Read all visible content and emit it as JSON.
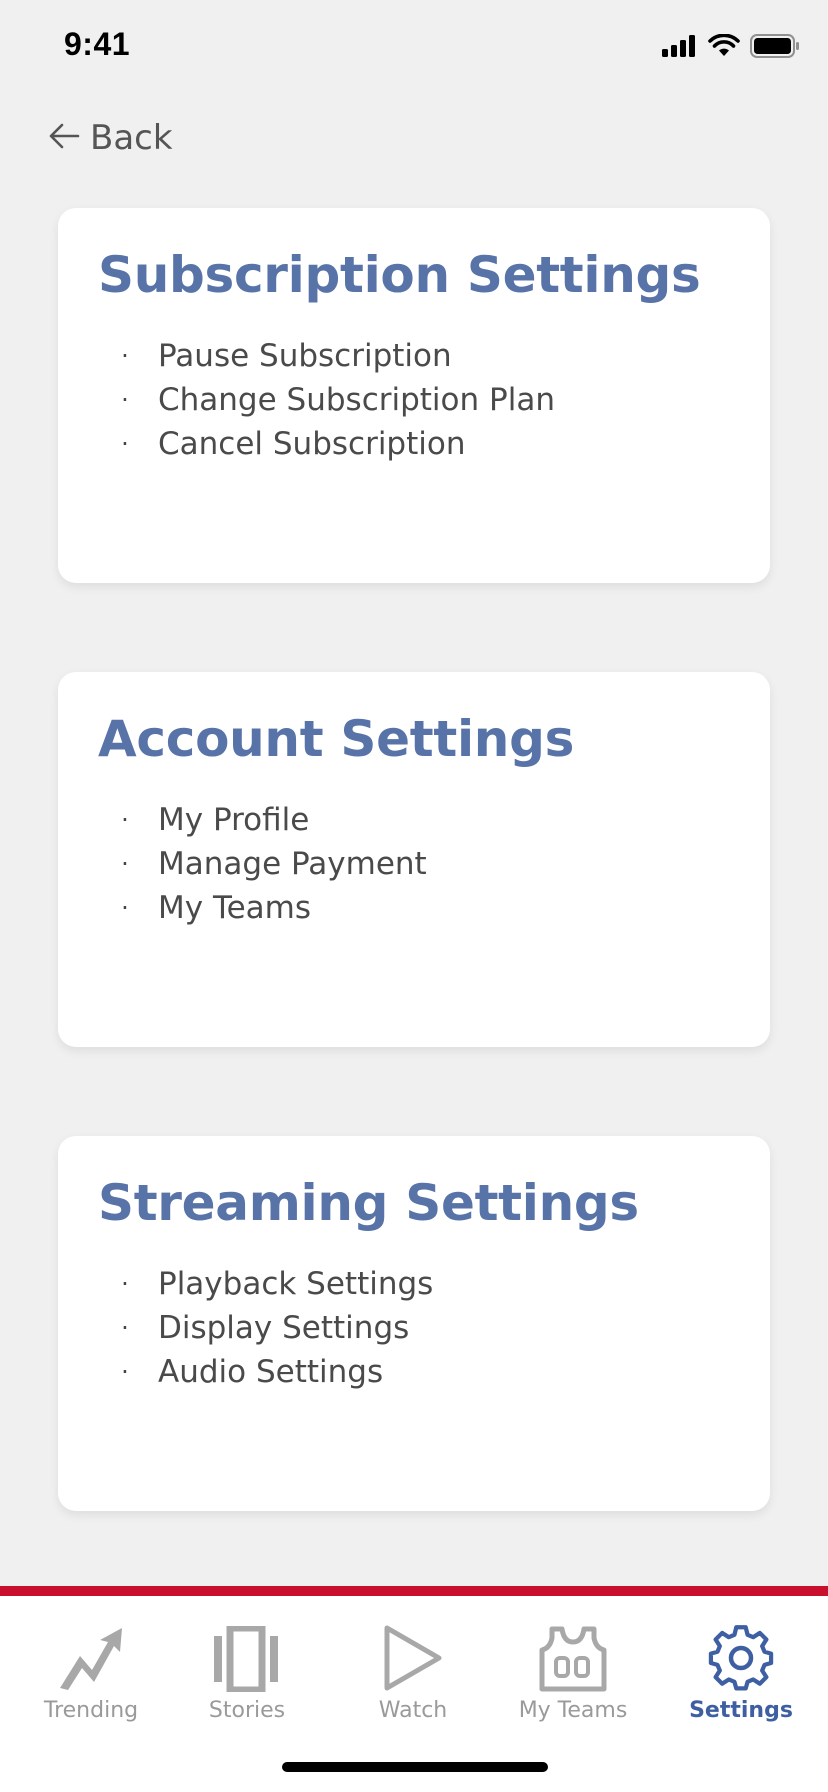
{
  "status_bar": {
    "time": "9:41"
  },
  "nav": {
    "back_label": "Back"
  },
  "cards": [
    {
      "title": "Subscription Settings",
      "items": [
        "Pause Subscription",
        "Change Subscription Plan",
        "Cancel Subscription"
      ]
    },
    {
      "title": "Account Settings",
      "items": [
        "My Profile",
        "Manage Payment",
        "My Teams"
      ]
    },
    {
      "title": "Streaming Settings",
      "items": [
        "Playback Settings",
        "Display Settings",
        "Audio Settings"
      ]
    }
  ],
  "bullet": "·",
  "tabbar": {
    "accent_color": "#c8102e",
    "active_color": "#3f5fa3",
    "inactive_color": "#9a9a9a",
    "tabs": [
      {
        "label": "Trending",
        "icon": "trending-icon",
        "active": false
      },
      {
        "label": "Stories",
        "icon": "stories-icon",
        "active": false
      },
      {
        "label": "Watch",
        "icon": "play-icon",
        "active": false
      },
      {
        "label": "My Teams",
        "icon": "jersey-icon",
        "active": false
      },
      {
        "label": "Settings",
        "icon": "gear-icon",
        "active": true
      }
    ]
  }
}
